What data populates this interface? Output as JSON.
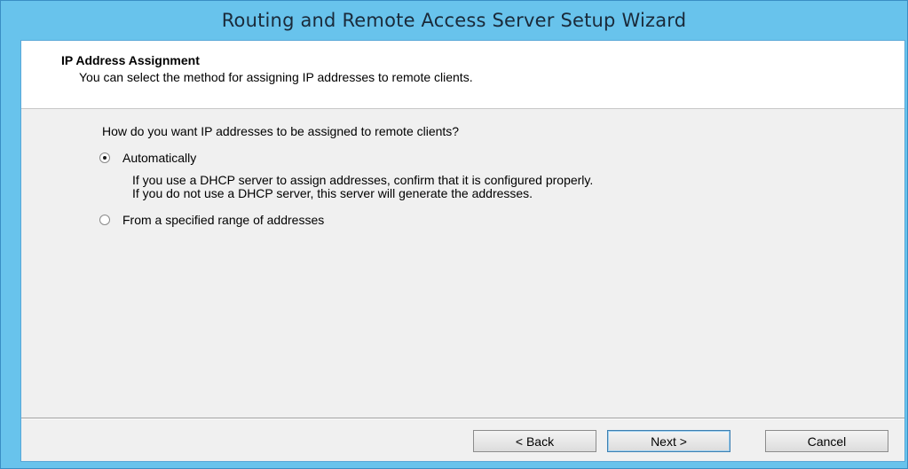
{
  "window": {
    "title": "Routing and Remote Access Server Setup Wizard"
  },
  "header": {
    "title": "IP Address Assignment",
    "subtitle": "You can select the method for assigning IP addresses to remote clients."
  },
  "question": "How do you want IP addresses to be assigned to remote clients?",
  "options": [
    {
      "label": "Automatically",
      "checked": true,
      "description_lines": [
        "If you use a DHCP server to assign addresses, confirm that it is configured properly.",
        "If you do not use a DHCP server, this server will generate the addresses."
      ]
    },
    {
      "label": "From a specified range of addresses",
      "checked": false
    }
  ],
  "buttons": {
    "back": "< Back",
    "next": "Next >",
    "cancel": "Cancel"
  },
  "colors": {
    "title_bar": "#68c3ec",
    "client_bg": "#f0f0f0",
    "header_bg": "#ffffff"
  }
}
